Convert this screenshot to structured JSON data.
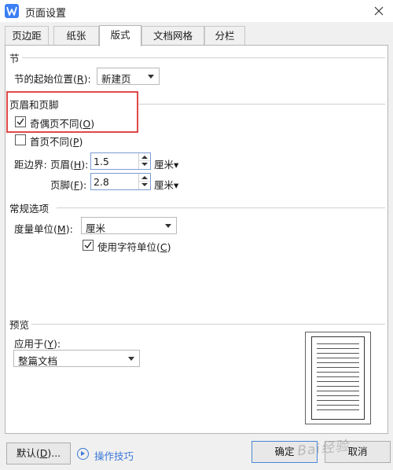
{
  "window": {
    "title": "页面设置",
    "app_icon_letter": "W"
  },
  "tabs": [
    {
      "label": "页边距",
      "active": false
    },
    {
      "label": "纸张",
      "active": false
    },
    {
      "label": "版式",
      "active": true
    },
    {
      "label": "文档网格",
      "active": false
    },
    {
      "label": "分栏",
      "active": false
    }
  ],
  "section": {
    "heading": "节",
    "start_label": "节的起始位置(",
    "start_key": "R",
    "start_label_tail": "):",
    "start_value": "新建页"
  },
  "header_footer": {
    "heading": "页眉和页脚",
    "odd_even": {
      "label": "奇偶页不同(",
      "key": "O",
      "tail": ")",
      "checked": true
    },
    "first_page": {
      "label": "首页不同(",
      "key": "P",
      "tail": ")",
      "checked": false
    },
    "distance_label": "距边界:",
    "header_label": "页眉(",
    "header_key": "H",
    "header_tail": "):",
    "header_value": "1.5",
    "header_unit": "厘米▾",
    "footer_label": "页脚(",
    "footer_key": "F",
    "footer_tail": "):",
    "footer_value": "2.8",
    "footer_unit": "厘米▾"
  },
  "general": {
    "heading": "常规选项",
    "measure_label": "度量单位(",
    "measure_key": "M",
    "measure_tail": "):",
    "measure_value": "厘米",
    "char_unit": {
      "label": "使用字符单位(",
      "key": "C",
      "tail": ")",
      "checked": true
    }
  },
  "preview": {
    "heading": "预览",
    "apply_label": "应用于(",
    "apply_key": "Y",
    "apply_tail": "):",
    "apply_value": "整篇文档"
  },
  "buttons": {
    "default_label": "默认(",
    "default_key": "D",
    "default_tail": ")...",
    "tips_label": "操作技巧",
    "ok_label": "确定",
    "cancel_label": "取消"
  },
  "colors": {
    "highlight": "#e04848",
    "accent": "#3b78d8",
    "icon_blue": "#3d7ff4"
  },
  "watermark": "Bai经验"
}
